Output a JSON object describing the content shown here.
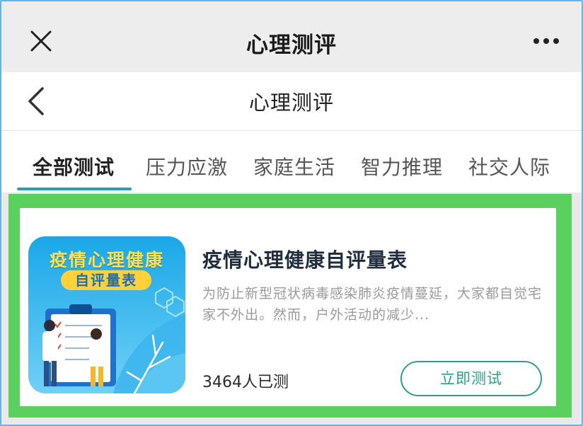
{
  "header": {
    "title": "心理测评",
    "close_icon": "close-icon",
    "more_icon": "more-icon"
  },
  "nav": {
    "title": "心理测评",
    "back_icon": "back-arrow-icon"
  },
  "tabs": [
    {
      "label": "全部测试",
      "active": true
    },
    {
      "label": "压力应激",
      "active": false
    },
    {
      "label": "家庭生活",
      "active": false
    },
    {
      "label": "智力推理",
      "active": false
    },
    {
      "label": "社交人际",
      "active": false
    }
  ],
  "colors": {
    "accent": "#2aa18a",
    "tab_underline": "#2f9bb5",
    "highlight": "#5ad15e"
  },
  "cards": [
    {
      "thumb_title": "疫情心理健康",
      "thumb_subtitle": "自评量表",
      "title": "疫情心理健康自评量表",
      "description": "为防止新型冠状病毒感染肺炎疫情蔓延，大家都自觉宅家不外出。然而，户外活动的减少...",
      "count": "3464人已测",
      "button_label": "立即测试"
    }
  ]
}
